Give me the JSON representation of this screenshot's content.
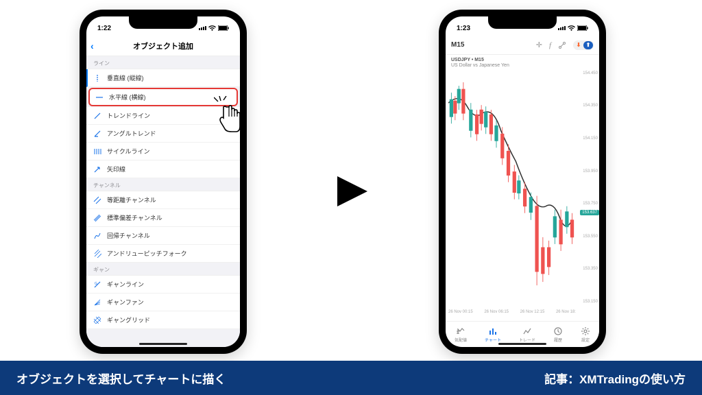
{
  "left_phone": {
    "time": "1:22",
    "title": "オブジェクト追加",
    "sections": [
      {
        "label": "ライン",
        "items": [
          {
            "label": "垂直線 (縦線)"
          },
          {
            "label": "水平線 (横線)"
          },
          {
            "label": "トレンドライン"
          },
          {
            "label": "アングルトレンド"
          },
          {
            "label": "サイクルライン"
          },
          {
            "label": "矢印線"
          }
        ]
      },
      {
        "label": "チャンネル",
        "items": [
          {
            "label": "等距離チャンネル"
          },
          {
            "label": "標準偏差チャンネル"
          },
          {
            "label": "回帰チャンネル"
          },
          {
            "label": "アンドリューピッチフォーク"
          }
        ]
      },
      {
        "label": "ギャン",
        "items": [
          {
            "label": "ギャンライン"
          },
          {
            "label": "ギャンファン"
          },
          {
            "label": "ギャングリッド"
          }
        ]
      }
    ]
  },
  "right_phone": {
    "time": "1:23",
    "timeframe": "M15",
    "symbol": "USDJPY • M15",
    "desc": "US Dollar vs Japanese Yen",
    "y_ticks": [
      "154.450",
      "154.350",
      "154.150",
      "153.950",
      "153.750",
      "153.550",
      "153.350",
      "153.150"
    ],
    "price_tag": "153.637",
    "x_ticks": [
      "26 Nov 00:15",
      "26 Nov 06:15",
      "26 Nov 12:15",
      "26 Nov 18:"
    ],
    "nav": [
      {
        "label": "気配値"
      },
      {
        "label": "チャート"
      },
      {
        "label": "トレード"
      },
      {
        "label": "履歴"
      },
      {
        "label": "設定"
      }
    ]
  },
  "footer": {
    "caption": "オブジェクトを選択してチャートに描く",
    "source": "記事：XMTradingの使い方"
  }
}
